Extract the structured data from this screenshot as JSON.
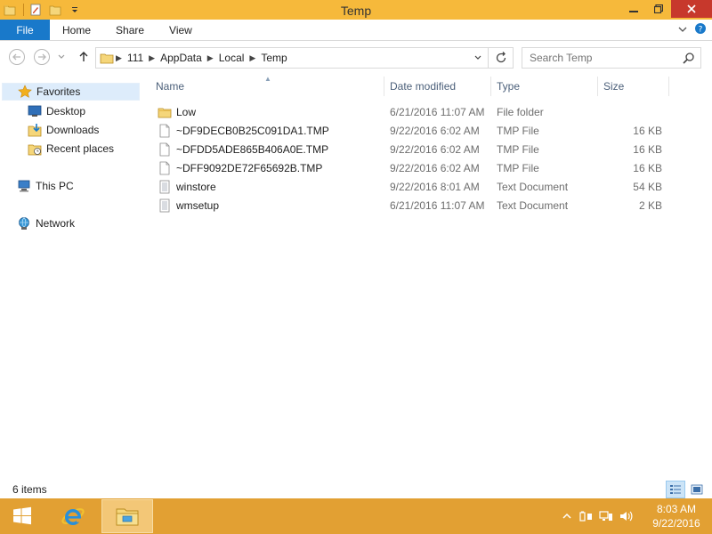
{
  "window": {
    "title": "Temp",
    "accent": "#f6b93b",
    "close_color": "#c7382c"
  },
  "ribbon": {
    "file_label": "File",
    "tabs": [
      "Home",
      "Share",
      "View"
    ]
  },
  "address": {
    "crumbs": [
      "111",
      "AppData",
      "Local",
      "Temp"
    ]
  },
  "search": {
    "placeholder": "Search Temp"
  },
  "nav": {
    "favorites": "Favorites",
    "desktop": "Desktop",
    "downloads": "Downloads",
    "recent": "Recent places",
    "thispc": "This PC",
    "network": "Network"
  },
  "columns": {
    "name": "Name",
    "date": "Date modified",
    "type": "Type",
    "size": "Size"
  },
  "files": [
    {
      "name": "Low",
      "date": "6/21/2016 11:07 AM",
      "type": "File folder",
      "size": "",
      "icon": "folder-icon"
    },
    {
      "name": "~DF9DECB0B25C091DA1.TMP",
      "date": "9/22/2016 6:02 AM",
      "type": "TMP File",
      "size": "16 KB",
      "icon": "blank-file-icon"
    },
    {
      "name": "~DFDD5ADE865B406A0E.TMP",
      "date": "9/22/2016 6:02 AM",
      "type": "TMP File",
      "size": "16 KB",
      "icon": "blank-file-icon"
    },
    {
      "name": "~DFF9092DE72F65692B.TMP",
      "date": "9/22/2016 6:02 AM",
      "type": "TMP File",
      "size": "16 KB",
      "icon": "blank-file-icon"
    },
    {
      "name": "winstore",
      "date": "9/22/2016 8:01 AM",
      "type": "Text Document",
      "size": "54 KB",
      "icon": "text-file-icon"
    },
    {
      "name": "wmsetup",
      "date": "6/21/2016 11:07 AM",
      "type": "Text Document",
      "size": "2 KB",
      "icon": "text-file-icon"
    }
  ],
  "status": {
    "count": "6 items"
  },
  "taskbar": {
    "time": "8:03 AM",
    "date": "9/22/2016",
    "color": "#e2a033"
  }
}
